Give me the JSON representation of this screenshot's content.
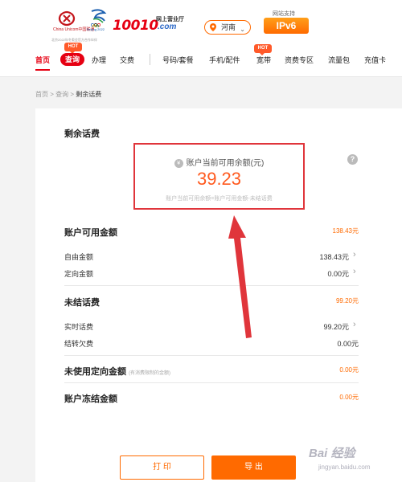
{
  "header": {
    "unicom_logo_text": "China Unicom中国联通",
    "olympic_logo_text": "Beijing 2022",
    "partner_text": "北京2022年冬奥会官方合作伙伴",
    "brand_number": "10010",
    "brand_sub": "网上营业厅",
    "brand_domain": ".com",
    "region": "河南",
    "ipv6_top": "网站支持",
    "ipv6_label": "IPv6"
  },
  "nav": {
    "home": "首页",
    "query": "查询",
    "handle": "办理",
    "pay": "交费",
    "number_plan": "号码/套餐",
    "phone_parts": "手机/配件",
    "broadband": "宽带",
    "tariff_zone": "资费专区",
    "data_pack": "流量包",
    "recharge_card": "充值卡",
    "hot_badge": "HOT"
  },
  "breadcrumb": {
    "home": "首页",
    "sep": " > ",
    "query": "查询",
    "current": "剩余话费"
  },
  "main": {
    "title": "剩余话费",
    "balance": {
      "label": "账户当前可用余额(元)",
      "yen": "¥",
      "value": "39.23",
      "formula": "账户当前可用余额=账户可用金额-未结话费",
      "help": "?"
    },
    "available": {
      "title": "账户可用金额",
      "total": "138.43元",
      "rows": [
        {
          "label": "自由金额",
          "value": "138.43元"
        },
        {
          "label": "定向金额",
          "value": "0.00元"
        }
      ]
    },
    "unsettled": {
      "title": "未结话费",
      "total": "99.20元",
      "rows": [
        {
          "label": "实时话费",
          "value": "99.20元"
        },
        {
          "label": "结转欠费",
          "value": "0.00元"
        }
      ]
    },
    "unused_directed": {
      "title": "未使用定向金额",
      "hint": "(有消费限制的金额)",
      "total": "0.00元"
    },
    "frozen": {
      "title": "账户冻结金额",
      "total": "0.00元"
    },
    "print_button": "打 印",
    "export_button": "导 出"
  },
  "watermark": {
    "main": "Bai 经验",
    "sub": "jingyan.baidu.com"
  },
  "colors": {
    "brand_red": "#e60012",
    "accent_orange": "#ff6a00",
    "annotation_red": "#e0353b"
  }
}
